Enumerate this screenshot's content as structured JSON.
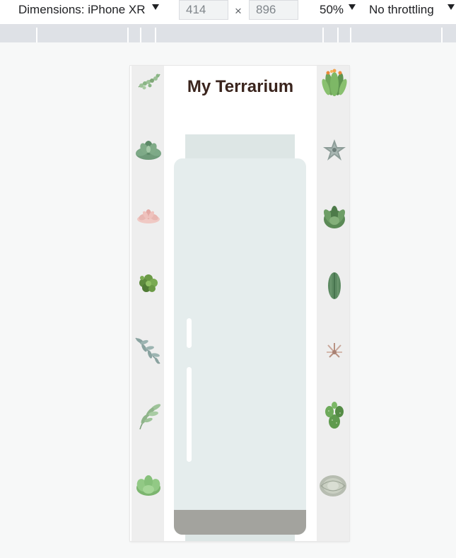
{
  "devtools": {
    "dimensions_label": "Dimensions: iPhone XR",
    "width_value": "414",
    "height_value": "896",
    "times_sign": "×",
    "zoom_label": "50%",
    "throttling_label": "No throttling"
  },
  "page": {
    "title": "My Terrarium"
  },
  "plants": {
    "left": [
      {
        "name": "plant1",
        "kind": "hanging-succulent",
        "color": "#7fa878"
      },
      {
        "name": "plant2",
        "kind": "echeveria-rosette",
        "color": "#6f9a79"
      },
      {
        "name": "plant3",
        "kind": "pink-rosette",
        "color": "#e8b7b2"
      },
      {
        "name": "plant4",
        "kind": "clustered-succulent",
        "color": "#5e8a3e"
      },
      {
        "name": "plant5",
        "kind": "eucalyptus-sprig",
        "color": "#8aa3a0"
      },
      {
        "name": "plant6",
        "kind": "leafy-sprig",
        "color": "#8fb48a"
      },
      {
        "name": "plant7",
        "kind": "jade-plant",
        "color": "#86c07a"
      }
    ],
    "right": [
      {
        "name": "plant8",
        "kind": "flowering-aloe",
        "color": "#6fa55a"
      },
      {
        "name": "plant9",
        "kind": "grey-star-succulent",
        "color": "#8d9c98"
      },
      {
        "name": "plant10",
        "kind": "agave-rosette",
        "color": "#5b8a56"
      },
      {
        "name": "plant11",
        "kind": "column-cactus",
        "color": "#5d8a62"
      },
      {
        "name": "plant12",
        "kind": "air-plant",
        "color": "#c9a79a"
      },
      {
        "name": "plant13",
        "kind": "prickly-pear",
        "color": "#5f9a4e"
      },
      {
        "name": "plant14",
        "kind": "round-cactus",
        "color": "#b7bdb1"
      }
    ]
  },
  "colors": {
    "title": "#3a241d",
    "jar": "#e5eded",
    "jar_rim": "#dde6e5",
    "dirt": "#a3a39e",
    "plant_column": "#eeeeee"
  }
}
